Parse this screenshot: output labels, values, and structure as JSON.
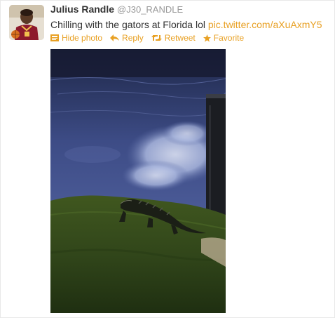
{
  "tweet": {
    "fullname": "Julius Randle",
    "username": "@J30_RANDLE",
    "text": "Chilling with the gators at Florida lol",
    "link": "pic.twitter.com/aXuAxmY5"
  },
  "actions": {
    "hide_photo": "Hide photo",
    "reply": "Reply",
    "retweet": "Retweet",
    "favorite": "Favorite"
  },
  "icons": {
    "hide_photo": "photo-icon",
    "reply": "reply-arrow-icon",
    "retweet": "retweet-icon",
    "favorite": "star-icon"
  },
  "colors": {
    "link": "#e8a023",
    "name": "#333333",
    "username": "#999999"
  }
}
